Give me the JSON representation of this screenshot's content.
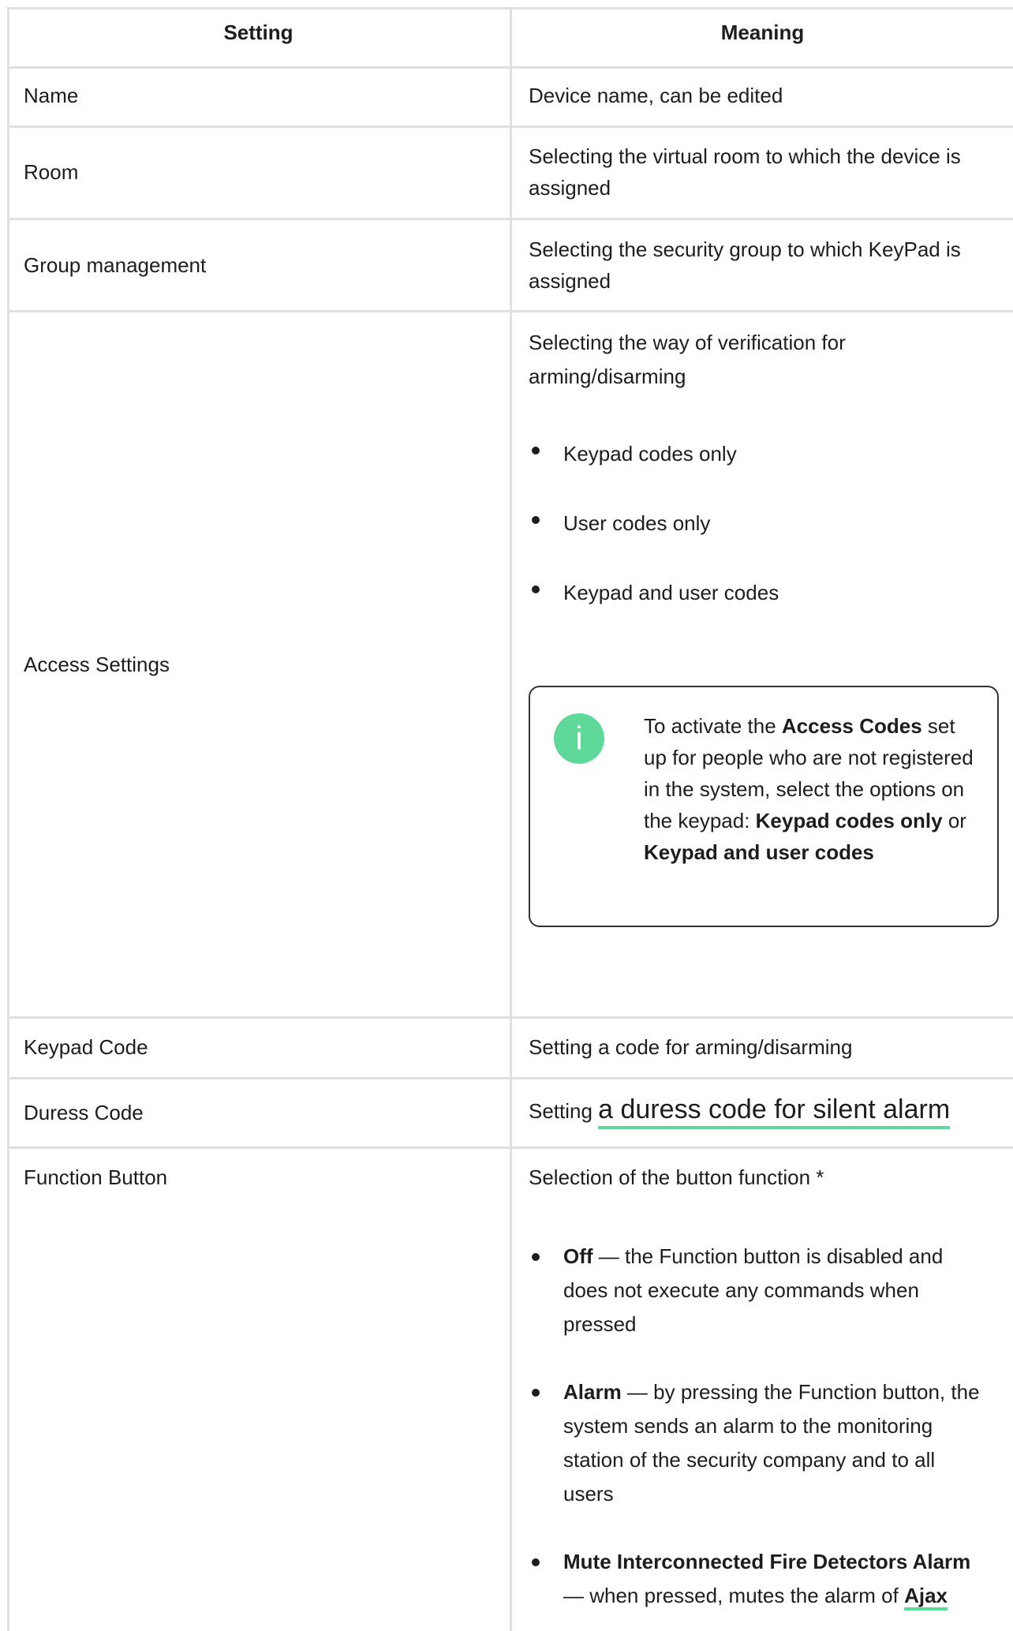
{
  "header": {
    "setting": "Setting",
    "meaning": "Meaning"
  },
  "rows": {
    "name": {
      "setting": "Name",
      "meaning": "Device name, can be edited"
    },
    "room": {
      "setting": "Room",
      "meaning": "Selecting the virtual room to which the device is assigned"
    },
    "group": {
      "setting": "Group management",
      "meaning": "Selecting the security group to which KeyPad is assigned"
    },
    "access": {
      "setting": "Access Settings",
      "meaning": "Selecting the way of verification for arming/disarming",
      "options": [
        "Keypad codes only",
        "User codes only",
        "Keypad and user codes"
      ],
      "note": {
        "icon": "info-icon",
        "icon_glyph": "i",
        "t1": "To activate the ",
        "b1": "Access Codes",
        "t2": " set up for people who are not registered in the system, select the options on the keypad: ",
        "b2": "Keypad codes only",
        "t3": " or ",
        "b3": "Keypad and user codes"
      }
    },
    "keypad_code": {
      "setting": "Keypad Code",
      "meaning": "Setting a code for arming/disarming"
    },
    "duress": {
      "setting": "Duress Code",
      "meaning_prefix": "Setting ",
      "meaning_link": "a duress code for silent alarm"
    },
    "function": {
      "setting": "Function Button",
      "meaning": "Selection of the button function *",
      "off_label": "Off",
      "off_text": " — the Function button is disabled and does not execute any commands when pressed",
      "alarm_label": "Alarm",
      "alarm_text": " — by pressing the Function button, the system sends an alarm to the monitoring station of the security company and to all users",
      "mute_label": "Mute Interconnected Fire Detectors Alarm",
      "mute_text": " — when pressed, mutes the alarm of ",
      "mute_link": "Ajax"
    }
  },
  "colors": {
    "accent": "#5fd99a",
    "border": "#e0e0e0",
    "text": "#1d1d1f"
  }
}
